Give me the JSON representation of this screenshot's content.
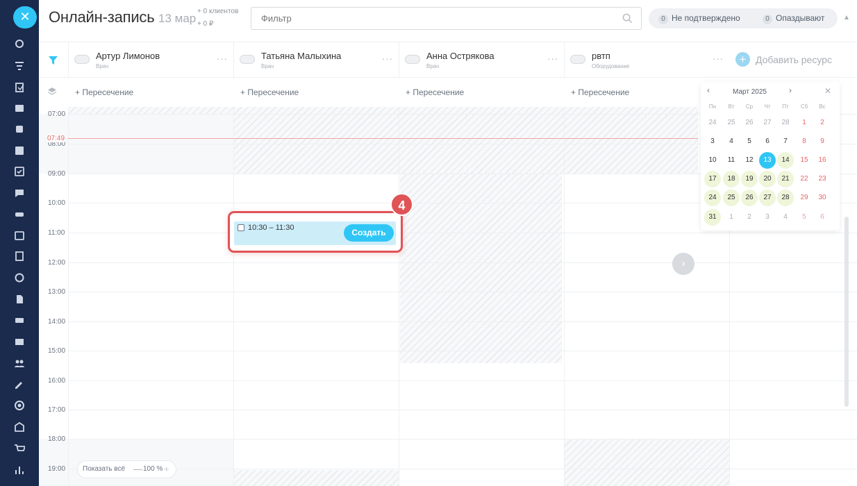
{
  "header": {
    "title": "Онлайн-запись",
    "date": "13 мар",
    "clients": "+ 0 клиентов",
    "price": "+ 0 ₽",
    "filter_placeholder": "Фильтр",
    "unconfirmed_count": "0",
    "unconfirmed_label": "Не подтверждено",
    "late_count": "0",
    "late_label": "Опаздывают"
  },
  "resources": [
    {
      "name": "Артур Лимонов",
      "type": "Врач",
      "intersection": "+ Пересечение"
    },
    {
      "name": "Татьяна Малыхина",
      "type": "Врач",
      "intersection": "+ Пересечение"
    },
    {
      "name": "Анна Острякова",
      "type": "Врач",
      "intersection": "+ Пересечение"
    },
    {
      "name": "рвтп",
      "type": "Оборудование",
      "intersection": "+ Пересечение"
    }
  ],
  "add_resource_label": "Добавить ресурс",
  "times": [
    "07:00",
    "08:00",
    "09:00",
    "10:00",
    "11:00",
    "12:00",
    "13:00",
    "14:00",
    "15:00",
    "16:00",
    "17:00",
    "18:00",
    "19:00"
  ],
  "now_time": "07:49",
  "event": {
    "time": "10:30 – 11:30",
    "create_label": "Создать",
    "step": "4"
  },
  "bottom": {
    "show_all": "Показать всё",
    "zoom_minus": "—",
    "zoom": "100 %",
    "zoom_plus": "+"
  },
  "calendar": {
    "month": "Март 2025",
    "weekdays": [
      "Пн",
      "Вт",
      "Ср",
      "Чт",
      "Пт",
      "Сб",
      "Вс"
    ],
    "weeks": [
      [
        "24",
        "25",
        "26",
        "27",
        "28",
        "1",
        "2"
      ],
      [
        "3",
        "4",
        "5",
        "6",
        "7",
        "8",
        "9"
      ],
      [
        "10",
        "11",
        "12",
        "13",
        "14",
        "15",
        "16"
      ],
      [
        "17",
        "18",
        "19",
        "20",
        "21",
        "22",
        "23"
      ],
      [
        "24",
        "25",
        "26",
        "27",
        "28",
        "29",
        "30"
      ],
      [
        "31",
        "1",
        "2",
        "3",
        "4",
        "5",
        "6"
      ]
    ],
    "today": "13"
  },
  "colors": {
    "accent": "#2fc6f6",
    "sidebar": "#1a2b4d",
    "highlight": "#e05356",
    "now_line": "#f4a3a3"
  },
  "sidebar_icons": [
    "crm-icon",
    "funnel-icon",
    "tasks-edit-icon",
    "contact-card-icon",
    "booking-icon",
    "inbox-icon",
    "checklist-icon",
    "chat-icon",
    "car-icon",
    "calendar-icon",
    "documents-icon",
    "analytics-icon",
    "file-icon",
    "drive-icon",
    "mail-icon",
    "users-icon",
    "sign-icon",
    "target-icon",
    "bank-icon",
    "cart-icon",
    "reports-icon"
  ]
}
